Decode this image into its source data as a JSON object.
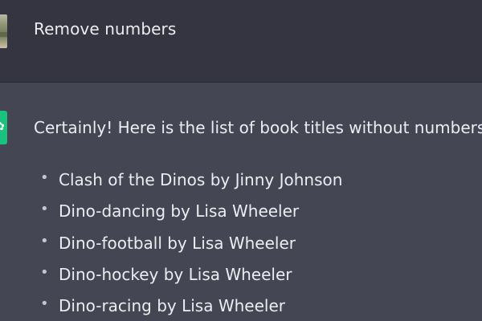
{
  "user_message": {
    "text": "Remove numbers"
  },
  "assistant_message": {
    "intro": "Certainly! Here is the list of book titles without numbers:",
    "books": [
      "Clash of the Dinos by Jinny Johnson",
      "Dino-dancing by Lisa Wheeler",
      "Dino-football by Lisa Wheeler",
      "Dino-hockey by Lisa Wheeler",
      "Dino-racing by Lisa Wheeler"
    ]
  },
  "colors": {
    "user_bg": "#343541",
    "assistant_bg": "#444654",
    "text": "#ececf1",
    "assistant_avatar": "#19c37d"
  },
  "icons": {
    "user_avatar": "user-avatar-photo",
    "assistant_avatar": "assistant-logo-icon"
  }
}
